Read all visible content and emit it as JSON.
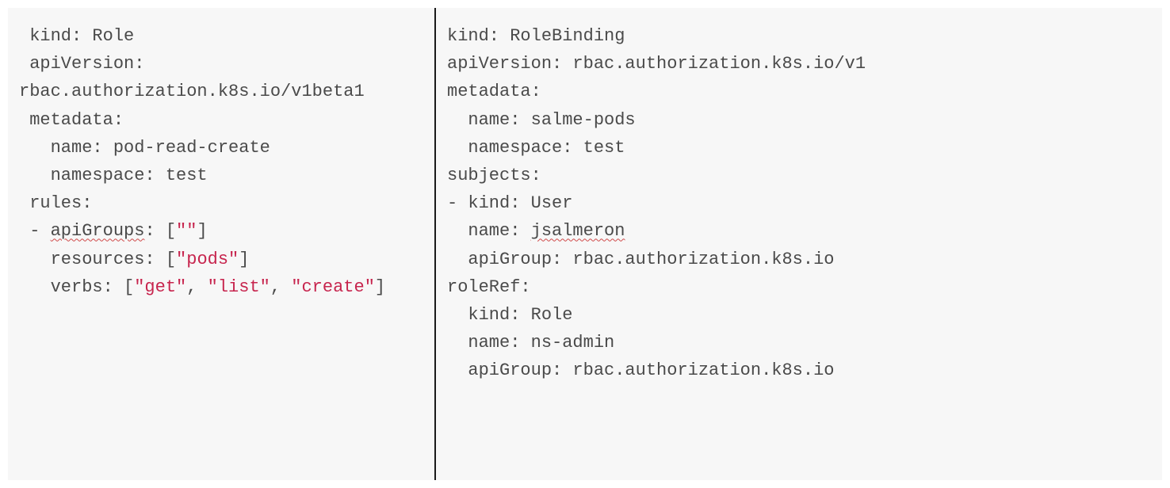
{
  "left": {
    "line1_label": " kind: ",
    "line1_value": "Role",
    "line2": " apiVersion:",
    "line3": "rbac.authorization.k8s.io/v1beta1",
    "line4": " metadata:",
    "line5": "   name: pod-read-create",
    "line6": "   namespace: test",
    "line7": " rules:",
    "line8_prefix": " - ",
    "line8_key": "apiGroups",
    "line8_mid": ": [",
    "line8_str": "\"\"",
    "line8_end": "]",
    "line9_prefix": "   resources: [",
    "line9_str": "\"pods\"",
    "line9_end": "]",
    "line10_prefix": "   verbs: [",
    "line10_s1": "\"get\"",
    "line10_c1": ", ",
    "line10_s2": "\"list\"",
    "line10_c2": ", ",
    "line10_s3": "\"create\"",
    "line10_end": "]"
  },
  "right": {
    "line1_label": "kind: ",
    "line1_value": "RoleBinding",
    "line2": "apiVersion: rbac.authorization.k8s.io/v1",
    "line3": "metadata:",
    "line4": "  name: salme-pods",
    "line5": "  namespace: test",
    "line6": "subjects:",
    "line7": "- kind: User",
    "line8_prefix": "  name: ",
    "line8_value": "jsalmeron",
    "line9": "  apiGroup: rbac.authorization.k8s.io",
    "line10": "roleRef:",
    "line11": "  kind: Role",
    "line12": "  name: ns-admin",
    "line13": "  apiGroup: rbac.authorization.k8s.io"
  }
}
